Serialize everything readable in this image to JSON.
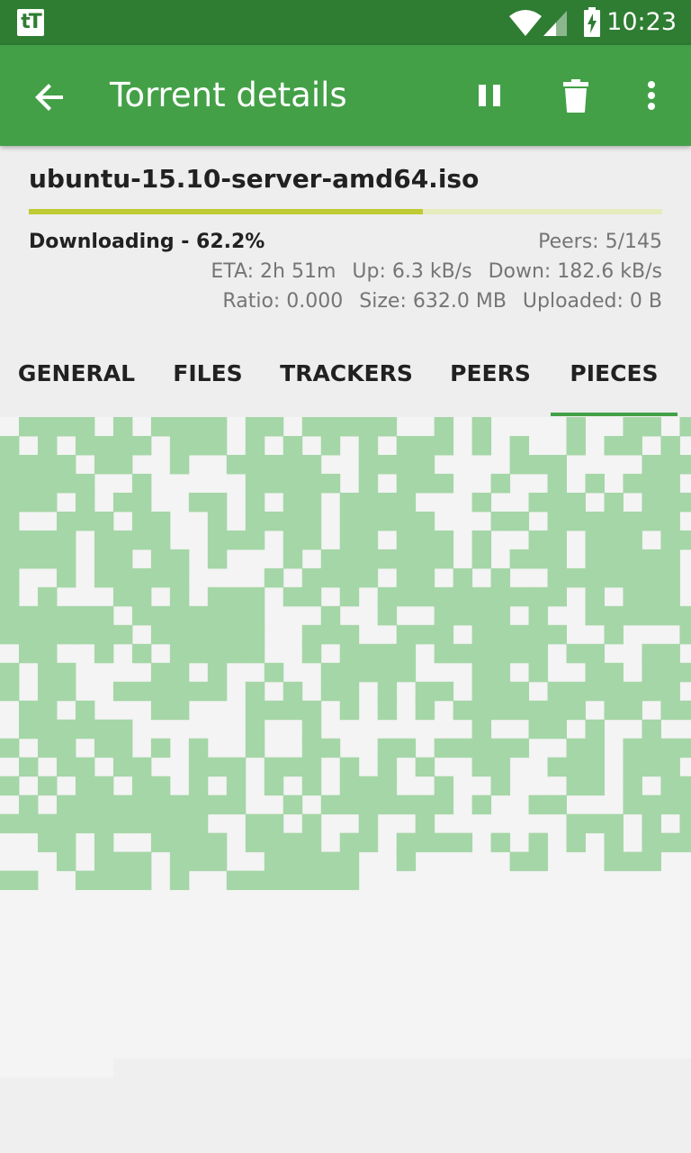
{
  "status_bar": {
    "app_icon_text": "tT",
    "time": "10:23"
  },
  "app_bar": {
    "title": "Torrent details",
    "icons": [
      "back-arrow-icon",
      "pause-icon",
      "delete-icon",
      "more-vert-icon"
    ]
  },
  "torrent": {
    "name": "ubuntu-15.10-server-amd64.iso",
    "progress_percent": 62.2,
    "status": "Downloading - 62.2%",
    "peers": "Peers: 5/145",
    "eta": "ETA: 2h 51m",
    "up": "Up: 6.3 kB/s",
    "down": "Down: 182.6 kB/s",
    "ratio": "Ratio: 0.000",
    "size": "Size: 632.0 MB",
    "uploaded": "Uploaded: 0 B"
  },
  "tabs": [
    {
      "label": "GENERAL",
      "selected": false
    },
    {
      "label": "FILES",
      "selected": false
    },
    {
      "label": "TRACKERS",
      "selected": false
    },
    {
      "label": "PEERS",
      "selected": false
    },
    {
      "label": "PIECES",
      "selected": true
    }
  ],
  "pieces": {
    "done_color": "#a5d6a7",
    "missing_color": "#f4f4f4",
    "columns": 37,
    "total": 907,
    "done_ratio": 0.622
  },
  "colors": {
    "status_bar": "#2e7d32",
    "app_bar": "#43a047",
    "progress": "#c0ca33",
    "progress_track": "#e6ebbd"
  }
}
